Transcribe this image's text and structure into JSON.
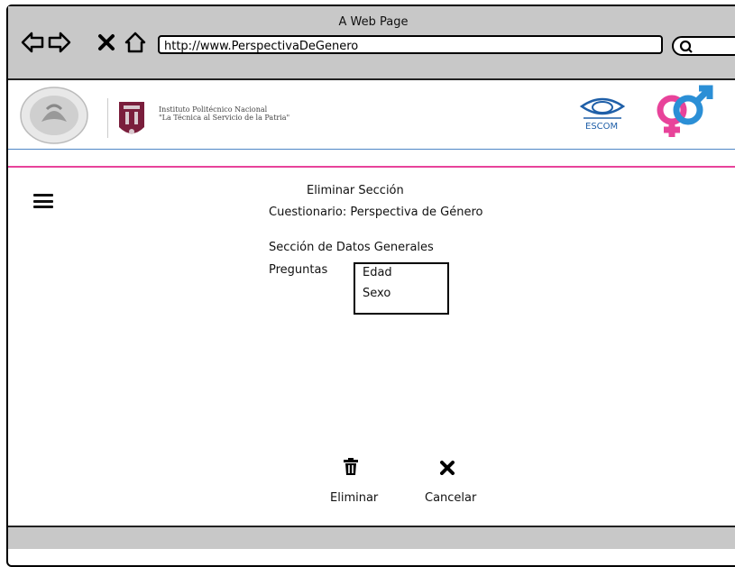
{
  "window": {
    "title": "A Web Page"
  },
  "browser": {
    "url": "http://www.PerspectivaDeGenero"
  },
  "header": {
    "institution_name": "Instituto Politécnico Nacional",
    "institution_motto": "\"La Técnica al Servicio de la Patria\"",
    "escom_label": "ESCOM"
  },
  "page": {
    "title": "Eliminar Sección",
    "questionnaire": "Cuestionario: Perspectiva de Género",
    "section": "Sección de Datos Generales",
    "questions_label": "Preguntas",
    "questions": [
      "Edad",
      "Sexo"
    ]
  },
  "actions": {
    "delete_label": "Eliminar",
    "cancel_label": "Cancelar"
  },
  "colors": {
    "accent_pink": "#e8439a",
    "accent_blue": "#4f86c6",
    "chrome_gray": "#c8c8c8"
  }
}
